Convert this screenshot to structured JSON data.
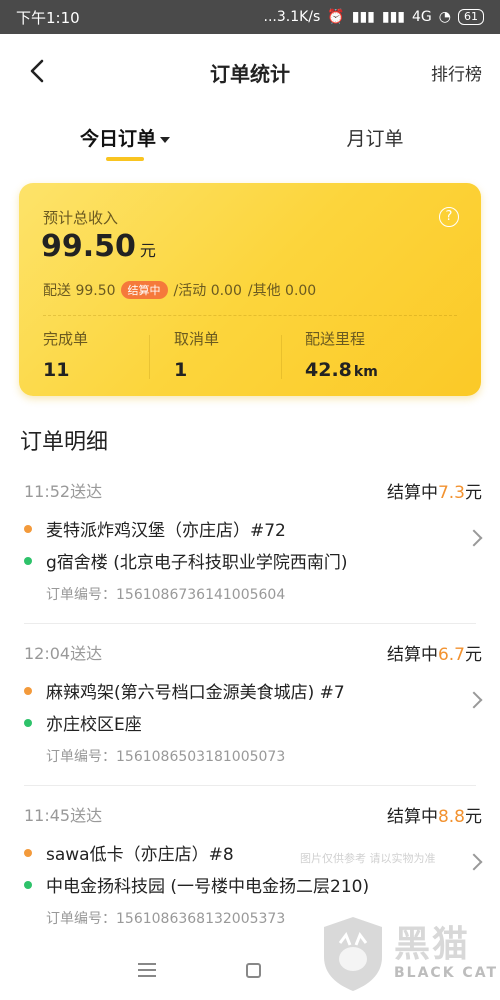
{
  "status_bar": {
    "time": "下午1:10",
    "speed": "...3.1K/s",
    "network": "4G",
    "battery": "61"
  },
  "header": {
    "title": "订单统计",
    "rank_link": "排行榜"
  },
  "tabs": [
    {
      "label": "今日订单",
      "active": true
    },
    {
      "label": "月订单",
      "active": false
    }
  ],
  "summary": {
    "label": "预计总收入",
    "amount": "99.50",
    "unit": "元",
    "delivery": "配送 99.50",
    "badge": "结算中",
    "activity": "/活动 0.00",
    "other": "/其他 0.00",
    "stats": [
      {
        "label": "完成单",
        "value": "11",
        "unit": ""
      },
      {
        "label": "取消单",
        "value": "1",
        "unit": ""
      },
      {
        "label": "配送里程",
        "value": "42.8",
        "unit": "km"
      }
    ]
  },
  "section_title": "订单明细",
  "orders": [
    {
      "time": "11:52送达",
      "status": "结算中",
      "amount": "7.3",
      "unit": "元",
      "pickup": "麦特派炸鸡汉堡（亦庄店）#72",
      "dropoff": "g宿舍楼 (北京电子科技职业学院西南门)",
      "order_no": "订单编号：1561086736141005604"
    },
    {
      "time": "12:04送达",
      "status": "结算中",
      "amount": "6.7",
      "unit": "元",
      "pickup": "麻辣鸡架(第六号档口金源美食城店) #7",
      "dropoff": "亦庄校区E座",
      "order_no": "订单编号：1561086503181005073"
    },
    {
      "time": "11:45送达",
      "status": "结算中",
      "amount": "8.8",
      "unit": "元",
      "pickup": "sawa低卡（亦庄店）#8",
      "dropoff": "中电金扬科技园 (一号楼中电金扬二层210)",
      "order_no": "订单编号：1561086368132005373"
    }
  ],
  "watermark": {
    "note": "图片仅供参考 请以实物为准",
    "logo_cn": "黑猫",
    "logo_en": "BLACK CAT"
  },
  "colors": {
    "accent_yellow": "#fcd53c",
    "amount_orange": "#f29230",
    "badge_orange": "#f5793b",
    "dot_green": "#2ec26a"
  }
}
